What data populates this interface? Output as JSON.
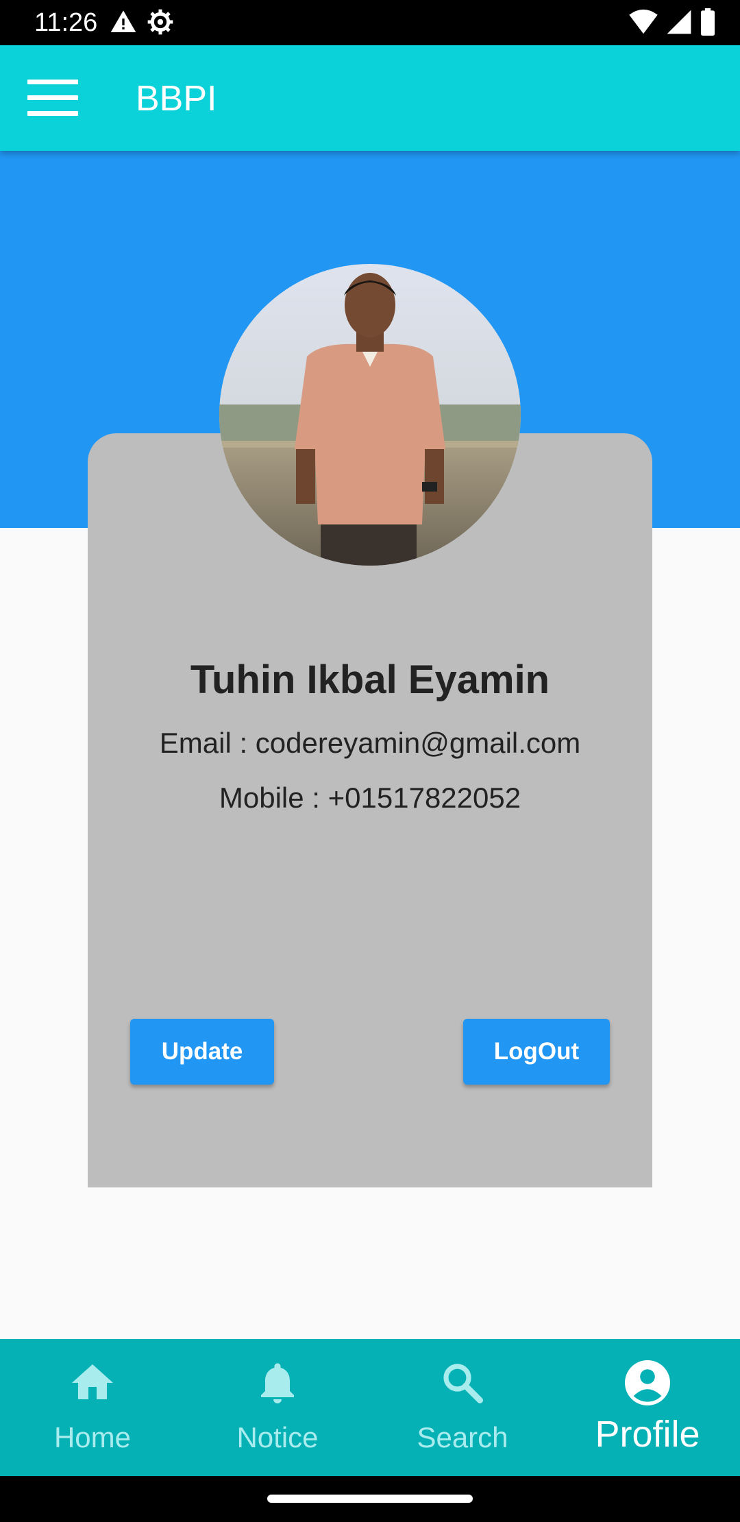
{
  "status_bar": {
    "time": "11:26",
    "left_icons": [
      "warning-icon",
      "settings-icon"
    ],
    "right_icons": [
      "wifi-icon",
      "signal-icon",
      "battery-icon"
    ]
  },
  "app_bar": {
    "title": "BBPI"
  },
  "profile": {
    "name": "Tuhin Ikbal Eyamin",
    "email_line": "Email : codereyamin@gmail.com",
    "mobile_line": "Mobile : +01517822052"
  },
  "actions": {
    "update_label": "Update",
    "logout_label": "LogOut"
  },
  "bottom_nav": {
    "items": [
      {
        "label": "Home",
        "icon": "home-icon"
      },
      {
        "label": "Notice",
        "icon": "bell-icon"
      },
      {
        "label": "Search",
        "icon": "search-icon"
      },
      {
        "label": "Profile",
        "icon": "account-circle-icon",
        "active": true
      }
    ]
  },
  "colors": {
    "app_bar": "#0bd2d9",
    "header_band": "#2196f3",
    "card": "#bdbdbd",
    "button": "#2196f3",
    "bottom_nav": "#06b1b5"
  }
}
